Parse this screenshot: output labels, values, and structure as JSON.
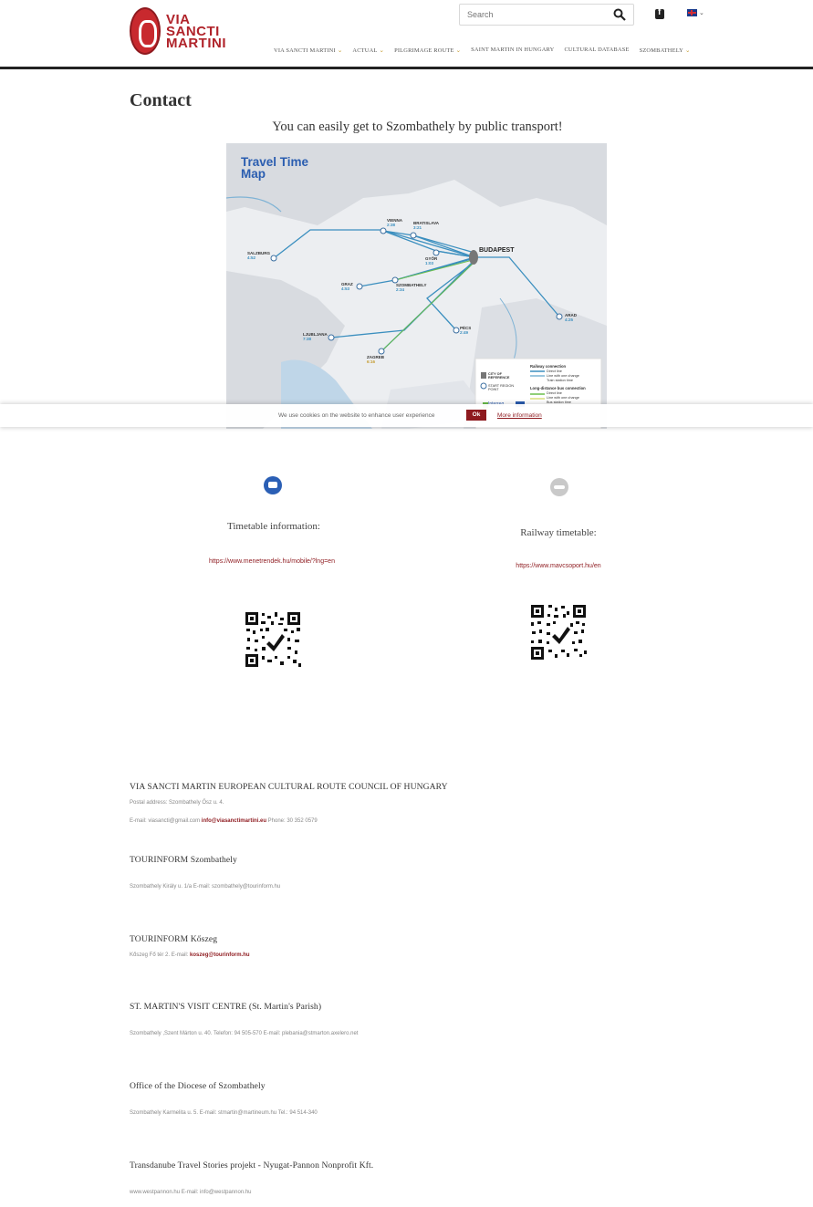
{
  "header": {
    "logo_text": [
      "VIA",
      "SANCTI",
      "MARTINI"
    ],
    "search_placeholder": "Search",
    "nav": [
      {
        "label": "VIA SANCTI MARTINI",
        "has_dropdown": true
      },
      {
        "label": "ACTUAL",
        "has_dropdown": true
      },
      {
        "label": "PILGRIMAGE ROUTE",
        "has_dropdown": true
      },
      {
        "label": "SAINT MARTIN IN HUNGARY",
        "has_dropdown": false
      },
      {
        "label": "CULTURAL DATABASE",
        "has_dropdown": false
      },
      {
        "label": "SZOMBATHELY",
        "has_dropdown": true
      }
    ]
  },
  "main": {
    "title": "Contact",
    "subtitle": "You can easily get to Szombathely by public transport!"
  },
  "map": {
    "title": "Travel Time Map",
    "cities": [
      {
        "name": "VIENNA",
        "time": "2:38"
      },
      {
        "name": "BRATISLAVA",
        "time": "3:21"
      },
      {
        "name": "BUDAPEST",
        "time": ""
      },
      {
        "name": "SALZBURG",
        "time": "4:52"
      },
      {
        "name": "GYŐR",
        "time": "1:03"
      },
      {
        "name": "GRAZ",
        "time": "4:53"
      },
      {
        "name": "SZOMBATHELY",
        "time": "2:34"
      },
      {
        "name": "ARAD",
        "time": "4:25"
      },
      {
        "name": "PÉCS",
        "time": "2:49"
      },
      {
        "name": "LJUBLJANA",
        "time": "7:38"
      },
      {
        "name": "ZAGREB",
        "time": "6:16"
      }
    ],
    "legend": {
      "city_of_reference": "CITY OF REFERENCE",
      "start_region": "START REGION POINT",
      "railway": "Railway connection",
      "railway_items": [
        "Direct line",
        "Line with one change",
        "Train station time"
      ],
      "bus": "Long-distance bus connection",
      "bus_items": [
        "Direct line",
        "Line with one change",
        "Bus station time"
      ],
      "interreg": "Interreg"
    }
  },
  "cookie": {
    "text": "We use cookies on the website to enhance user experience",
    "ok_label": "Ok",
    "more_label": "More information"
  },
  "transport": {
    "timetable_label": "Timetable information:",
    "timetable_url": "https://www.menetrendek.hu/mobile/?lng=en",
    "railway_label": "Railway timetable:",
    "railway_url": "https://www.mavcsoport.hu/en"
  },
  "contacts": {
    "council_title": "VIA SANCTI MARTIN EUROPEAN CULTURAL ROUTE COUNCIL OF HUNGARY",
    "council_postal": "Postal address: Szombathely Ősz u. 4.",
    "council_email_prefix": "E-mail: viasancti@gmail.com",
    "council_email_link": "info@viasanctimartini.eu",
    "council_phone": "Phone: 30 352 0579",
    "tourinform_szom_title": "TOURINFORM Szombathely",
    "tourinform_szom_line": "Szombathely Király u. 1/a  E-mail: szombathely@tourinform.hu",
    "tourinform_kos_title": "TOURINFORM Kőszeg",
    "tourinform_kos_prefix": "Kőszeg Fő tér 2. E-mail:",
    "tourinform_kos_link": "koszeg@tourinform.hu",
    "visit_centre_title": "ST. MARTIN'S VISIT CENTRE (St. Martin's Parish)",
    "visit_centre_line": "Szombathely ,Szent Márton u. 40.  Telefon: 94 505-570    E-mail: plebania@stmarton.axelero.net",
    "diocese_title": "Office of the Diocese of Szombathely",
    "diocese_line": "Szombathely Karmelita u. 5. E-mail: stmartin@martineum.hu  Tel.: 94 514-340",
    "transdanube_title": "Transdanube Travel Stories projekt - Nyugat-Pannon Nonprofit Kft.",
    "transdanube_line": "www.westpannon.hu E-mail: info@westpannon.hu"
  }
}
